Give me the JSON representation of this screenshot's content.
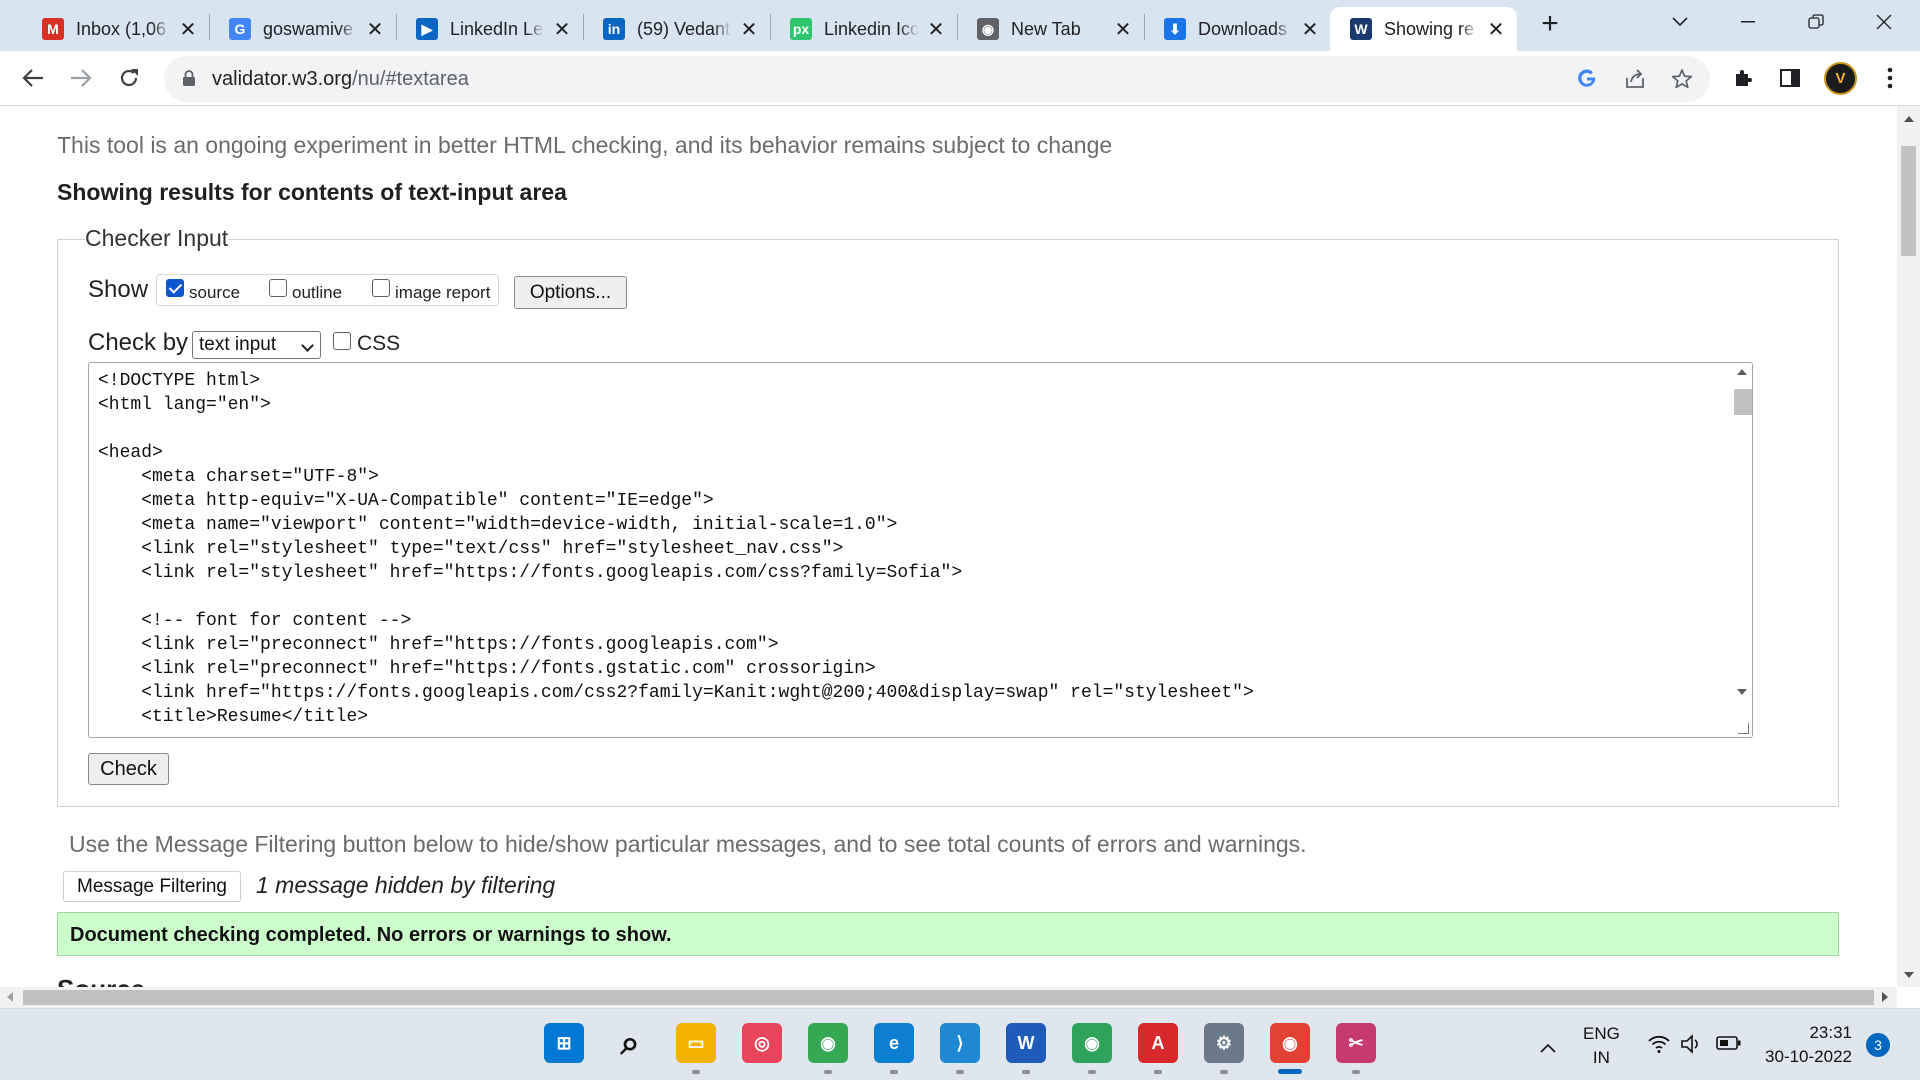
{
  "browser": {
    "tabs": [
      {
        "title": "Inbox (1,06",
        "icon": "gmail-icon",
        "color": "#d93025",
        "glyph": "M"
      },
      {
        "title": "goswamive",
        "icon": "google-icon",
        "color": "#4285f4",
        "glyph": "G"
      },
      {
        "title": "LinkedIn Le",
        "icon": "linkedin-learning-icon",
        "color": "#0a66c2",
        "glyph": "▶"
      },
      {
        "title": "(59) Vedant",
        "icon": "linkedin-icon",
        "color": "#0a66c2",
        "glyph": "in"
      },
      {
        "title": "Linkedin Ico",
        "icon": "pixabay-icon",
        "color": "#2ec66d",
        "glyph": "px"
      },
      {
        "title": "New Tab",
        "icon": "chrome-icon",
        "color": "#5f6368",
        "glyph": "◉"
      },
      {
        "title": "Downloads",
        "icon": "download-icon",
        "color": "#1a73e8",
        "glyph": "⬇"
      },
      {
        "title": "Showing re",
        "icon": "w3c-validator-icon",
        "color": "#1a3a6e",
        "glyph": "W"
      }
    ],
    "active_tab_index": 7,
    "url_host": "validator.w3.org",
    "url_path": "/nu/#textarea"
  },
  "page": {
    "intro": "This tool is an ongoing experiment in better HTML checking, and its behavior remains subject to change",
    "results_title": "Showing results for contents of text-input area",
    "checker_legend": "Checker Input",
    "show_label": "Show",
    "show_options": [
      {
        "label": "source",
        "checked": true
      },
      {
        "label": "outline",
        "checked": false
      },
      {
        "label": "image report",
        "checked": false
      }
    ],
    "options_button": "Options...",
    "check_by_label": "Check by",
    "check_by_value": "text input",
    "css_label": "CSS",
    "css_checked": false,
    "source_code": "<!DOCTYPE html>\n<html lang=\"en\">\n\n<head>\n    <meta charset=\"UTF-8\">\n    <meta http-equiv=\"X-UA-Compatible\" content=\"IE=edge\">\n    <meta name=\"viewport\" content=\"width=device-width, initial-scale=1.0\">\n    <link rel=\"stylesheet\" type=\"text/css\" href=\"stylesheet_nav.css\">\n    <link rel=\"stylesheet\" href=\"https://fonts.googleapis.com/css?family=Sofia\">\n\n    <!-- font for content -->\n    <link rel=\"preconnect\" href=\"https://fonts.googleapis.com\">\n    <link rel=\"preconnect\" href=\"https://fonts.gstatic.com\" crossorigin>\n    <link href=\"https://fonts.googleapis.com/css2?family=Kanit:wght@200;400&display=swap\" rel=\"stylesheet\">\n    <title>Resume</title>",
    "check_button": "Check",
    "filter_note": "Use the Message Filtering button below to hide/show particular messages, and to see total counts of errors and warnings.",
    "filter_button": "Message Filtering",
    "hidden_message": "1 message hidden by filtering",
    "success_message": "Document checking completed. No errors or warnings to show.",
    "source_heading": "Source",
    "success_bg": "#ccffcc"
  },
  "taskbar": {
    "apps": [
      {
        "name": "windows-start-icon",
        "color": "#0078d4",
        "glyph": "⊞"
      },
      {
        "name": "search-icon",
        "color": "transparent",
        "glyph": "⌕"
      },
      {
        "name": "file-explorer-icon",
        "color": "#f2b300",
        "glyph": "▭"
      },
      {
        "name": "creative-cloud-icon",
        "color": "#e8455b",
        "glyph": "◎"
      },
      {
        "name": "chrome-icon",
        "color": "#34a853",
        "glyph": "◉"
      },
      {
        "name": "edge-icon",
        "color": "#0c7fd0",
        "glyph": "e"
      },
      {
        "name": "vscode-icon",
        "color": "#1e88d3",
        "glyph": "⟩"
      },
      {
        "name": "word-icon",
        "color": "#1f5bb8",
        "glyph": "W"
      },
      {
        "name": "chrome-canary-icon",
        "color": "#2fa35a",
        "glyph": "◉"
      },
      {
        "name": "acrobat-icon",
        "color": "#d7282c",
        "glyph": "A"
      },
      {
        "name": "settings-icon",
        "color": "#6b7a8a",
        "glyph": "⚙"
      },
      {
        "name": "chrome-profile-icon",
        "color": "#e34133",
        "glyph": "◉"
      },
      {
        "name": "snipping-tool-icon",
        "color": "#c63a6e",
        "glyph": "✂"
      }
    ],
    "language_top": "ENG",
    "language_bottom": "IN",
    "time": "23:31",
    "date": "30-10-2022",
    "notification_count": "3"
  }
}
